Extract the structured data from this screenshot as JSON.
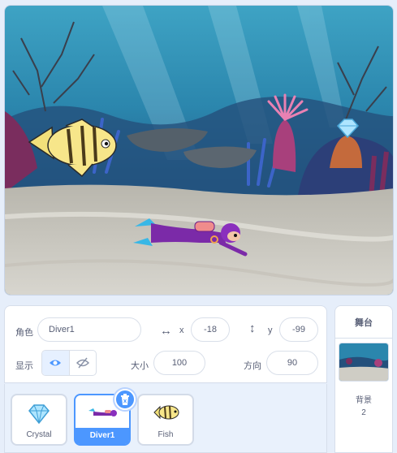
{
  "stage": {
    "backdrop_icon": "underwater-reef-backdrop",
    "sprites_shown": [
      "Fish",
      "Diver1",
      "Crystal"
    ]
  },
  "sprite_info": {
    "sprite_label": "角色",
    "sprite_name": "Diver1",
    "x_label": "x",
    "x_value": "-18",
    "y_label": "y",
    "y_value": "-99",
    "show_label": "显示",
    "size_label": "大小",
    "size_value": "100",
    "direction_label": "方向",
    "direction_value": "90"
  },
  "sprite_list": {
    "items": [
      {
        "name": "Crystal",
        "icon": "crystal-icon"
      },
      {
        "name": "Diver1",
        "icon": "diver-icon",
        "selected": true
      },
      {
        "name": "Fish",
        "icon": "fish-icon"
      }
    ]
  },
  "stage_panel": {
    "title": "舞台",
    "backdrops_label": "背景",
    "backdrops_count": "2"
  },
  "colors": {
    "accent": "#4c97ff",
    "text": "#575e75",
    "panel_bg": "#e9f1fc"
  }
}
